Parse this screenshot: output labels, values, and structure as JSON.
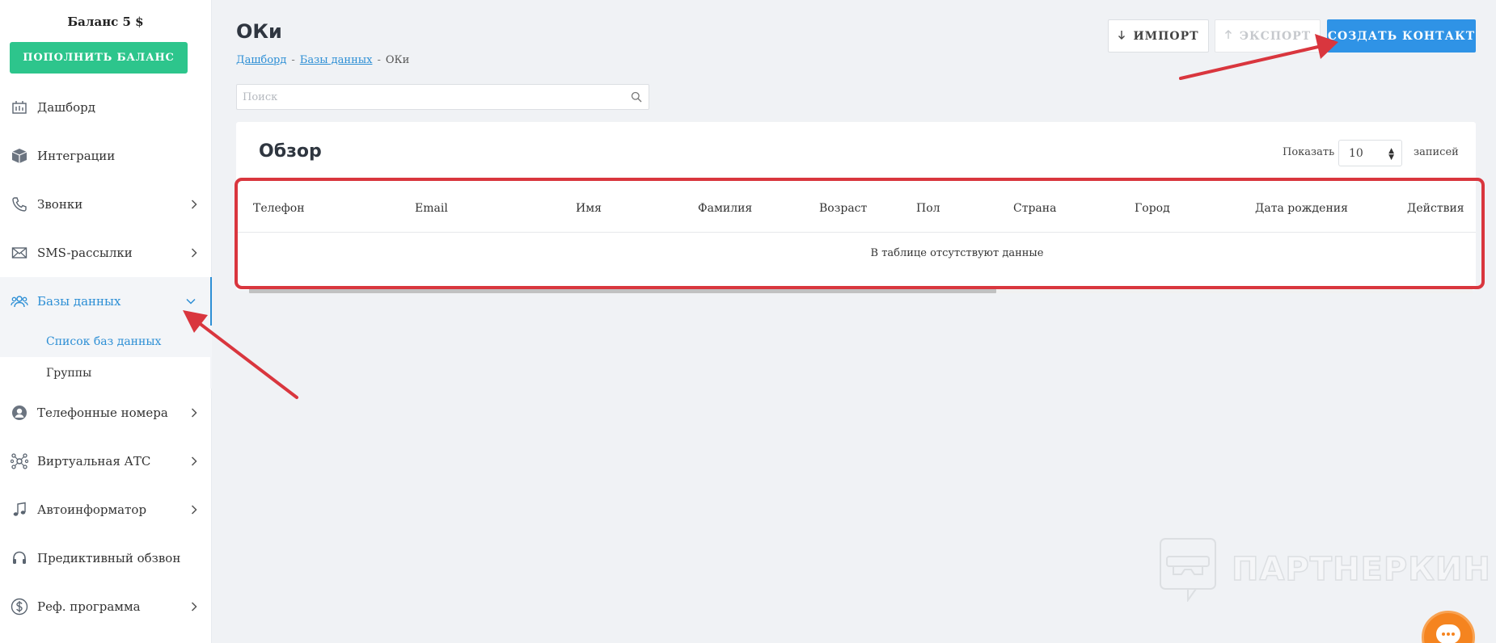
{
  "sidebar": {
    "balance": "Баланс 5 $",
    "topup_label": "ПОПОЛНИТЬ БАЛАНС",
    "items": [
      {
        "label": "Дашборд",
        "icon": "dashboard-icon"
      },
      {
        "label": "Интеграции",
        "icon": "box-icon"
      },
      {
        "label": "Звонки",
        "icon": "phone-icon"
      },
      {
        "label": "SMS-рассылки",
        "icon": "envelope-icon"
      },
      {
        "label": "Базы данных",
        "icon": "users-icon"
      },
      {
        "label": "Телефонные номера",
        "icon": "user-circle-icon"
      },
      {
        "label": "Виртуальная АТС",
        "icon": "network-icon"
      },
      {
        "label": "Автоинформатор",
        "icon": "music-note-icon"
      },
      {
        "label": "Предиктивный обзвон",
        "icon": "headset-icon"
      },
      {
        "label": "Реф. программа",
        "icon": "dollar-icon"
      }
    ],
    "submenu": [
      {
        "label": "Список баз данных"
      },
      {
        "label": "Группы"
      }
    ]
  },
  "header": {
    "title": "ОКи",
    "breadcrumb": [
      "Дашборд",
      "Базы данных",
      "ОКи"
    ],
    "breadcrumb_sep": "-",
    "import_label": "ИМПОРТ",
    "export_label": "ЭКСПОРТ",
    "create_label": "СОЗДАТЬ КОНТАКТ"
  },
  "search": {
    "placeholder": "Поиск",
    "value": ""
  },
  "overview": {
    "title": "Обзор",
    "show_label": "Показать",
    "page_size": "10",
    "records_label": "записей",
    "columns": [
      "Телефон",
      "Email",
      "Имя",
      "Фамилия",
      "Возраст",
      "Пол",
      "Страна",
      "Город",
      "Дата рождения",
      "Действия"
    ],
    "empty_text": "В таблице отсутствуют данные"
  },
  "watermark": "ПАРТНЕРКИН",
  "colors": {
    "accent": "#2f93e6",
    "success": "#2dc58c",
    "annotation": "#d9363e",
    "chat": "#f5841f"
  }
}
